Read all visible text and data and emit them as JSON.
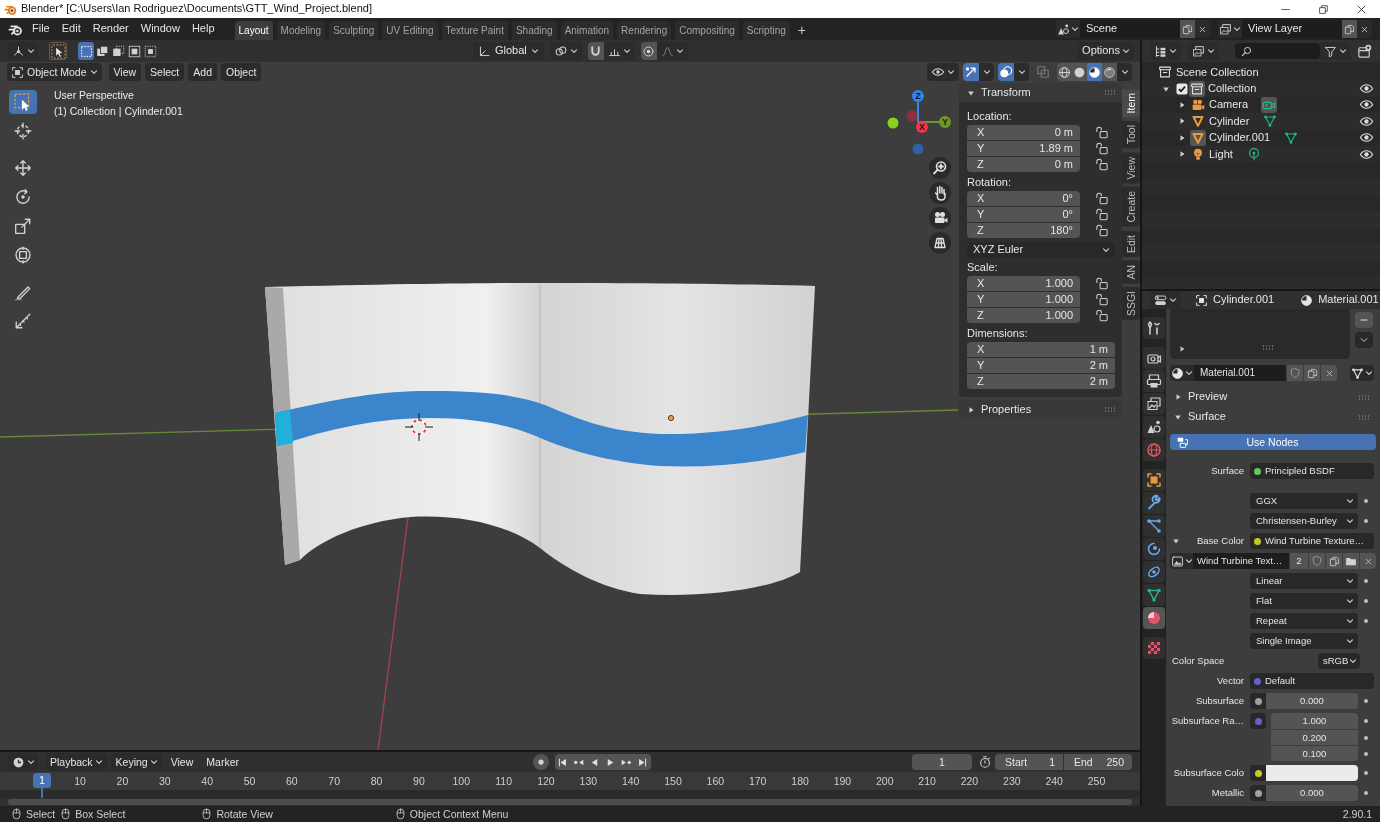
{
  "window": {
    "title": "Blender* [C:\\Users\\Ian Rodriguez\\Documents\\GTT_Wind_Project.blend]"
  },
  "menu_bar": [
    "File",
    "Edit",
    "Render",
    "Window",
    "Help"
  ],
  "workspace_tabs": [
    {
      "label": "Layout",
      "selected": true
    },
    {
      "label": "Modeling",
      "selected": false
    },
    {
      "label": "Sculpting",
      "selected": false
    },
    {
      "label": "UV Editing",
      "selected": false
    },
    {
      "label": "Texture Paint",
      "selected": false
    },
    {
      "label": "Shading",
      "selected": false
    },
    {
      "label": "Animation",
      "selected": false
    },
    {
      "label": "Rendering",
      "selected": false
    },
    {
      "label": "Compositing",
      "selected": false
    },
    {
      "label": "Scripting",
      "selected": false
    }
  ],
  "add_workspace": "+",
  "scene": "Scene",
  "view_layer": "View Layer",
  "viewport": {
    "tool_header": {
      "select_modes": [
        {
          "selected": true
        },
        {
          "selected": false
        },
        {
          "selected": false
        },
        {
          "selected": false
        },
        {
          "selected": false
        }
      ],
      "orientation": "Global",
      "options": "Options"
    },
    "header": {
      "mode": "Object Mode",
      "menus": [
        "View",
        "Select",
        "Add",
        "Object"
      ],
      "show_gizmos": true,
      "show_overlays": true,
      "shading": [
        {
          "kind": "wireframe",
          "selected": false
        },
        {
          "kind": "solid",
          "selected": false
        },
        {
          "kind": "material",
          "selected": true
        },
        {
          "kind": "rendered",
          "selected": false
        }
      ]
    },
    "tools": [
      {
        "kind": "select",
        "selected": true
      },
      {
        "kind": "cursor",
        "selected": false
      },
      {
        "kind": "move",
        "selected": false
      },
      {
        "kind": "rotate",
        "selected": false
      },
      {
        "kind": "scale",
        "selected": false
      },
      {
        "kind": "transform",
        "selected": false
      },
      {
        "kind": "annotate",
        "selected": false
      },
      {
        "kind": "measure",
        "selected": false
      }
    ],
    "view_info": [
      "User Perspective",
      "(1) Collection | Cylinder.001"
    ],
    "gizmo": {
      "axes": [
        {
          "label": "Z",
          "color": "#2f84e5"
        },
        {
          "label": "Y",
          "color": "#6d9a25"
        },
        {
          "label": "X",
          "color": "#f0364f"
        }
      ],
      "negative_axes": [
        {
          "color": "#8c3040"
        },
        {
          "color": "#8bd21e"
        },
        {
          "color": "#2e62a8"
        }
      ]
    },
    "sidebar": {
      "panels": [
        {
          "title": "Transform",
          "expanded": true,
          "groups": [
            {
              "kind": "vector",
              "label": "Location:",
              "locks": true,
              "fields": [
                {
                  "axis": "X",
                  "value": "0 m"
                },
                {
                  "axis": "Y",
                  "value": "1.89 m"
                },
                {
                  "axis": "Z",
                  "value": "0 m"
                }
              ]
            },
            {
              "kind": "vector",
              "label": "Rotation:",
              "locks": true,
              "fields": [
                {
                  "axis": "X",
                  "value": "0°"
                },
                {
                  "axis": "Y",
                  "value": "0°"
                },
                {
                  "axis": "Z",
                  "value": "180°"
                }
              ]
            },
            {
              "kind": "dropdown",
              "value": "XYZ Euler"
            },
            {
              "kind": "vector",
              "label": "Scale:",
              "locks": true,
              "fields": [
                {
                  "axis": "X",
                  "value": "1.000"
                },
                {
                  "axis": "Y",
                  "value": "1.000"
                },
                {
                  "axis": "Z",
                  "value": "1.000"
                }
              ]
            },
            {
              "kind": "vector",
              "label": "Dimensions:",
              "locks": false,
              "fields": [
                {
                  "axis": "X",
                  "value": "1 m"
                },
                {
                  "axis": "Y",
                  "value": "2 m"
                },
                {
                  "axis": "Z",
                  "value": "2 m"
                }
              ]
            }
          ]
        },
        {
          "title": "Properties",
          "expanded": false
        }
      ],
      "tabs": [
        {
          "label": "Item",
          "selected": true
        },
        {
          "label": "Tool",
          "selected": false
        },
        {
          "label": "View",
          "selected": false
        },
        {
          "label": "Create",
          "selected": false
        },
        {
          "label": "Edit",
          "selected": false
        },
        {
          "label": "AN",
          "selected": false
        },
        {
          "label": "SSGI",
          "selected": false
        }
      ]
    }
  },
  "outliner": {
    "tree": [
      {
        "label": "Scene Collection",
        "kind": "scene_collection",
        "children": [
          {
            "label": "Collection",
            "kind": "collection",
            "expanded": true,
            "checked": true,
            "active": true,
            "visible": true,
            "children": [
              {
                "label": "Camera",
                "kind": "camera",
                "expanded": false,
                "active": false,
                "data_active": true,
                "visible": true
              },
              {
                "label": "Cylinder",
                "kind": "mesh",
                "expanded": false,
                "active": false,
                "data_active": false,
                "visible": true
              },
              {
                "label": "Cylinder.001",
                "kind": "mesh",
                "expanded": false,
                "active": true,
                "data_active": false,
                "visible": true
              },
              {
                "label": "Light",
                "kind": "light",
                "expanded": false,
                "active": false,
                "data_active": false,
                "visible": true
              }
            ]
          }
        ]
      }
    ]
  },
  "properties": {
    "breadcrumb": [
      {
        "kind": "object",
        "label": "Cylinder.001"
      },
      {
        "kind": "material",
        "label": "Material.001"
      }
    ],
    "tabs": [
      {
        "kind": "tool",
        "selected": false
      },
      {
        "kind": "render",
        "selected": false
      },
      {
        "kind": "output",
        "selected": false
      },
      {
        "kind": "view_layer",
        "selected": false
      },
      {
        "kind": "scene",
        "selected": false
      },
      {
        "kind": "world",
        "selected": false
      },
      {
        "kind": "object",
        "selected": false
      },
      {
        "kind": "modifiers",
        "selected": false
      },
      {
        "kind": "particles",
        "selected": false
      },
      {
        "kind": "physics",
        "selected": false
      },
      {
        "kind": "constraints",
        "selected": false
      },
      {
        "kind": "data",
        "selected": false
      },
      {
        "kind": "material",
        "selected": true
      },
      {
        "kind": "texture",
        "selected": false
      }
    ],
    "material": "Material.001",
    "panels": [
      {
        "title": "Preview",
        "expanded": false
      },
      {
        "title": "Surface",
        "expanded": true,
        "use_nodes": {
          "label": "Use Nodes",
          "on": true
        },
        "rows": [
          {
            "kind": "link",
            "label": "Surface",
            "value": "Principled BSDF",
            "color": "#63c763",
            "decorator": false
          },
          {
            "kind": "dropdown",
            "value": "GGX",
            "decorator": true
          },
          {
            "kind": "dropdown",
            "value": "Christensen-Burley",
            "decorator": true
          },
          {
            "kind": "link",
            "label": "Base Color",
            "value": "Wind Turbine Texture…",
            "color": "#c7c729",
            "expanded": true,
            "decorator": false
          },
          {
            "kind": "image",
            "name": "Wind Turbine Text…",
            "users": "2"
          },
          {
            "kind": "dropdown",
            "value": "Linear",
            "decorator": true
          },
          {
            "kind": "dropdown",
            "value": "Flat",
            "decorator": true
          },
          {
            "kind": "dropdown",
            "value": "Repeat",
            "decorator": true
          },
          {
            "kind": "dropdown",
            "value": "Single Image",
            "decorator": false
          },
          {
            "kind": "select",
            "label": "Color Space",
            "value": "sRGB"
          },
          {
            "kind": "link",
            "label": "Vector",
            "value": "Default",
            "color": "#6363c7",
            "decorator": false
          },
          {
            "kind": "number",
            "label": "Subsurface",
            "values": [
              "0.000"
            ],
            "color": "#a1a1a1",
            "decorator": true
          },
          {
            "kind": "number",
            "label": "Subsurface Ra…",
            "values": [
              "1.000",
              "0.200",
              "0.100"
            ],
            "color": "#6363c7",
            "decorator": true
          },
          {
            "kind": "color",
            "label": "Subsurface Colo",
            "color": "#c7c729",
            "decorator": true
          },
          {
            "kind": "number",
            "label": "Metallic",
            "values": [
              "0.000"
            ],
            "color": "#a1a1a1",
            "decorator": true
          }
        ]
      }
    ]
  },
  "timeline": {
    "menus": [
      {
        "label": "Playback",
        "kind": "dropdown"
      },
      {
        "label": "Keying",
        "kind": "dropdown"
      },
      {
        "label": "View",
        "kind": "menu"
      },
      {
        "label": "Marker",
        "kind": "menu"
      }
    ],
    "current_frame": "1",
    "start": {
      "label": "Start",
      "value": "1"
    },
    "end": {
      "label": "End",
      "value": "250"
    },
    "playhead": "1",
    "ruler": [
      "10",
      "20",
      "30",
      "40",
      "50",
      "60",
      "70",
      "80",
      "90",
      "100",
      "110",
      "120",
      "130",
      "140",
      "150",
      "160",
      "170",
      "180",
      "190",
      "200",
      "210",
      "220",
      "230",
      "240",
      "250"
    ]
  },
  "status_bar": {
    "hints": [
      "Select",
      "Box Select",
      "Rotate View",
      "Object Context Menu"
    ],
    "version": "2.90.1"
  }
}
